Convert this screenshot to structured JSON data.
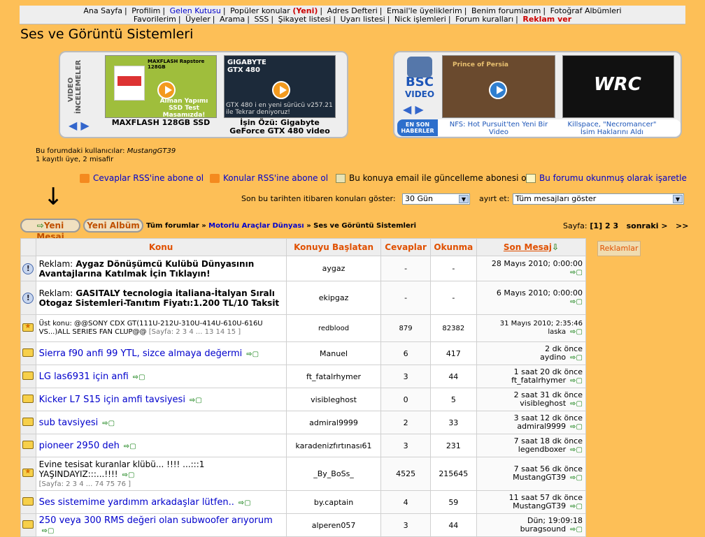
{
  "topnav": {
    "row1": [
      "Ana Sayfa",
      "Profilim",
      "Gelen Kutusu",
      "Popüler konular",
      "(Yeni)",
      "Adres Defteri",
      "Email'le üyeliklerim",
      "Benim forumlarım",
      "Fotoğraf Albümleri"
    ],
    "row2": [
      "Favorilerim",
      "Üyeler",
      "Arama",
      "SSS",
      "Şikayet listesi",
      "Uyarı listesi",
      "Nick işlemleri",
      "Forum kuralları",
      "Reklam ver"
    ]
  },
  "page_title": "Ses ve Görüntü Sistemleri",
  "promo_left": {
    "side_label": "VIDEO İNCELEMELER",
    "items": [
      {
        "thumb_text": "MAXFLASH Rapstore 128GB",
        "overlay": "Alman Yapımı SSD Test Masamızda!",
        "caption": "MAXFLASH 128GB SSD"
      },
      {
        "thumb_text": "GIGABYTE GTX 480",
        "overlay": "GTX 480 i en yeni sürücü v257.21 ile Tekrar deniyoruz!",
        "caption": "İşin Özü: Gigabyte GeForce GTX 480 video"
      }
    ]
  },
  "promo_right": {
    "logo_big": "BSC",
    "logo_small": "VIDEO",
    "thumb_left_text": "Prince of Persia",
    "thumb_right_text": "WRC",
    "news_tag": "EN SON HABERLER",
    "news": [
      "NFS: Hot Pursuit'ten Yeni Bir Video",
      "Killspace, \"Necromancer\" İsim Haklarını Aldı"
    ]
  },
  "users": {
    "line1_label": "Bu forumdaki kullanıcılar:",
    "line1_user": "MustangGT39",
    "line2": "1 kayıtlı üye, 2 misafir"
  },
  "actions": {
    "rss_replies": "Cevaplar RSS'ine abone ol",
    "rss_topics": "Konular RSS'ine abone ol",
    "email_sub": "Bu konuya email ile güncelleme abonesi ol",
    "mark_read": "Bu forumu okunmuş olarak işaretle"
  },
  "filter": {
    "label": "Son bu tarihten itibaren konuları göster:",
    "days_value": "30 Gün",
    "sort_label": "ayırt et:",
    "sort_value": "Tüm mesajları göster"
  },
  "buttons": {
    "new_post": "Yeni Mesaj",
    "new_album": "Yeni Albüm"
  },
  "breadcrumb": {
    "root": "Tüm forumlar",
    "parent": "Motorlu Araçlar Dünyası",
    "current": "Ses ve Görüntü Sistemleri",
    "sep": "»"
  },
  "pager": {
    "label": "Sayfa:",
    "current": "[1]",
    "pages": [
      "2",
      "3"
    ],
    "next": "sonraki >",
    "last": ">>"
  },
  "ads_box": "Reklamlar",
  "table": {
    "headers": {
      "topic": "Konu",
      "starter": "Konuyu Başlatan",
      "replies": "Cevaplar",
      "views": "Okunma",
      "last": "Son Mesaj"
    },
    "rows": [
      {
        "type": "ad",
        "prefix": "Reklam:",
        "title": "Aygaz Dönüşümcü Kulübü Dünyasının Avantajlarına Katılmak İçin Tıklayın!",
        "starter": "aygaz",
        "replies": "-",
        "views": "-",
        "last_date": "28 Mayıs 2010; 0:00:00",
        "last_user": ""
      },
      {
        "type": "ad",
        "prefix": "Reklam:",
        "title": "GASITALY tecnologia italiana-İtalyan Sıralı Otogaz Sistemleri-Tanıtım Fiyatı:1.200 TL/10 Taksit",
        "starter": "ekipgaz",
        "replies": "-",
        "views": "-",
        "last_date": "6 Mayıs 2010; 0:00:00",
        "last_user": ""
      },
      {
        "type": "sticky",
        "prefix": "Üst konu:",
        "title": "@@SONY CDX GT(111U-212U-310U-414U-610U-616U VS...)ALL SERIES FAN CLUP@@",
        "pages": "[Sayfa: 2 3 4 ... 13 14 15 ]",
        "starter": "redblood",
        "replies": "879",
        "views": "82382",
        "last_date": "31 Mayıs 2010; 2:35:46",
        "last_user": "laska"
      },
      {
        "type": "link",
        "title": "Sierra f90 anfi 99 YTL, sizce almaya değermi",
        "starter": "Manuel",
        "replies": "6",
        "views": "417",
        "last_date": "2 dk önce",
        "last_user": "aydino"
      },
      {
        "type": "link",
        "title": "LG las6931 için anfi",
        "starter": "ft_fatalrhymer",
        "replies": "3",
        "views": "44",
        "last_date": "1 saat 20 dk önce",
        "last_user": "ft_fatalrhymer"
      },
      {
        "type": "link",
        "title": "Kicker L7 S15 için amfi tavsiyesi",
        "starter": "visibleghost",
        "replies": "0",
        "views": "5",
        "last_date": "2 saat 31 dk önce",
        "last_user": "visibleghost"
      },
      {
        "type": "link",
        "title": "sub tavsiyesi",
        "starter": "admiral9999",
        "replies": "2",
        "views": "33",
        "last_date": "3 saat 12 dk önce",
        "last_user": "admiral9999"
      },
      {
        "type": "link",
        "title": "pioneer 2950 deh",
        "starter": "karadenizfırtınası61",
        "replies": "3",
        "views": "231",
        "last_date": "7 saat 18 dk önce",
        "last_user": "legendboxer"
      },
      {
        "type": "hot",
        "title": "Evine tesisat kuranlar klübü... !!!! ...:::1 YAŞINDAYIZ:::...!!!!",
        "pages": "[Sayfa: 2 3 4 ... 74 75 76 ]",
        "starter": "_By_BoSs_",
        "replies": "4525",
        "views": "215645",
        "last_date": "7 saat 56 dk önce",
        "last_user": "MustangGT39"
      },
      {
        "type": "link",
        "title": "Ses sistemime yardımm arkadaşlar lütfen..",
        "starter": "by.captain",
        "replies": "4",
        "views": "59",
        "last_date": "11 saat 57 dk önce",
        "last_user": "MustangGT39"
      },
      {
        "type": "link",
        "title": "250 veya 300 RMS değeri olan subwoofer arıyorum",
        "starter": "alperen057",
        "replies": "3",
        "views": "44",
        "last_date": "Dün; 19:09:18",
        "last_user": "buragsound"
      }
    ]
  }
}
